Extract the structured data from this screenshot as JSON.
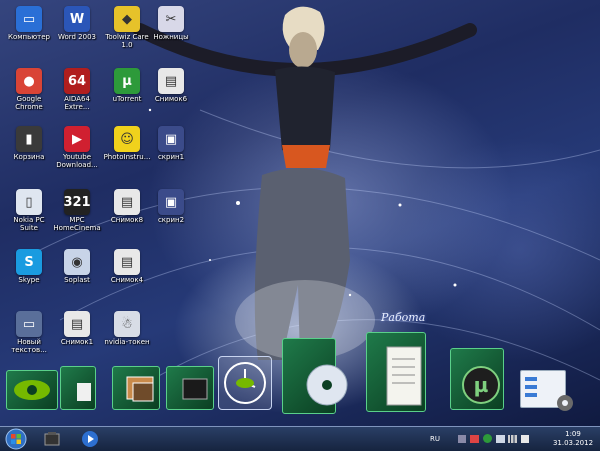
{
  "desktop": {
    "icons": [
      {
        "label": "Компьютер",
        "icon": "computer-icon",
        "color": "#2a6fd6",
        "glyph": "▭"
      },
      {
        "label": "Word 2003",
        "icon": "word-icon",
        "color": "#2b56b8",
        "glyph": "W"
      },
      {
        "label": "Toolwiz Care\n1.0",
        "icon": "shield-icon",
        "color": "#e6c22a",
        "glyph": "◆"
      },
      {
        "label": "Ножницы",
        "icon": "scissors-icon",
        "color": "#d8d8e8",
        "glyph": "✂"
      },
      {
        "label": "Google\nChrome",
        "icon": "chrome-icon",
        "color": "#d94436",
        "glyph": "●"
      },
      {
        "label": "AIDA64\nExtre...",
        "icon": "aida64-icon",
        "color": "#b01e1e",
        "glyph": "64"
      },
      {
        "label": "uTorrent",
        "icon": "utorrent-icon",
        "color": "#2d9a3a",
        "glyph": "µ"
      },
      {
        "label": "Снимок6",
        "icon": "screenshot-icon",
        "color": "#e8e8e8",
        "glyph": "▤"
      },
      {
        "label": "Корзина",
        "icon": "recycle-bin-icon",
        "color": "#3a3a3a",
        "glyph": "▮"
      },
      {
        "label": "Youtube\nDownload...",
        "icon": "youtube-downloader-icon",
        "color": "#d02030",
        "glyph": "▶"
      },
      {
        "label": "PhotoInstru...",
        "icon": "photoinstrument-icon",
        "color": "#f0d21c",
        "glyph": "☺"
      },
      {
        "label": "скрин1",
        "icon": "image-file-icon",
        "color": "#3b4b8a",
        "glyph": "▣"
      },
      {
        "label": "Nokia PC\nSuite",
        "icon": "nokia-suite-icon",
        "color": "#dfe6f0",
        "glyph": "▯"
      },
      {
        "label": "MPC\nHomeCinema",
        "icon": "mpc-icon",
        "color": "#222222",
        "glyph": "321"
      },
      {
        "label": "Снимок8",
        "icon": "screenshot-icon",
        "color": "#e8e8e8",
        "glyph": "▤"
      },
      {
        "label": "скрин2",
        "icon": "image-file-icon",
        "color": "#3b4b8a",
        "glyph": "▣"
      },
      {
        "label": "Skype",
        "icon": "skype-icon",
        "color": "#1a9be0",
        "glyph": "S"
      },
      {
        "label": "Soplast",
        "icon": "sopcast-icon",
        "color": "#c8d4e8",
        "glyph": "◉"
      },
      {
        "label": "Снимок4",
        "icon": "screenshot-icon",
        "color": "#e8e8e8",
        "glyph": "▤"
      },
      {
        "label": "Новый\nтекстов...",
        "icon": "text-file-icon",
        "color": "#5a6f9a",
        "glyph": "▭"
      },
      {
        "label": "Снимок1",
        "icon": "screenshot-icon",
        "color": "#e8e8e8",
        "glyph": "▤"
      },
      {
        "label": "nvidia-токен",
        "icon": "nvidia-robot-icon",
        "color": "#d8dde6",
        "glyph": "☃"
      }
    ],
    "signature": "Работа"
  },
  "dock": [
    {
      "icon": "nvidia-folder-icon"
    },
    {
      "icon": "green-folder-icon"
    },
    {
      "icon": "photos-folder-icon"
    },
    {
      "icon": "video-folder-icon"
    },
    {
      "icon": "clock-icon"
    },
    {
      "icon": "disc-folder-icon"
    },
    {
      "icon": "documents-folder-icon"
    },
    {
      "icon": "utorrent-dock-icon"
    },
    {
      "icon": "settings-window-icon"
    }
  ],
  "taskbar": {
    "start_icon": "windows-start-icon",
    "pinned": [
      "explorer-icon",
      "media-player-icon"
    ],
    "language": "RU",
    "time": "1:09",
    "date": "31.03.2012",
    "tray_icons": [
      "network-icon",
      "display-icon",
      "utorrent-tray-icon",
      "volume-icon",
      "signal-icon",
      "flag-icon"
    ]
  },
  "colors": {
    "accent": "#2a3f66",
    "text": "#ffffff"
  }
}
